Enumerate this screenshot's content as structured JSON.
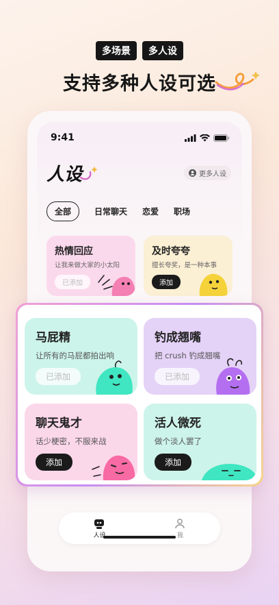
{
  "promo": {
    "tags": [
      "多场景",
      "多人设"
    ],
    "headline": "支持多种人设可选"
  },
  "status_bar": {
    "time": "9:41"
  },
  "page": {
    "title": "人设",
    "more_label": "更多人设"
  },
  "filters": [
    "全部",
    "日常聊天",
    "恋爱",
    "职场"
  ],
  "small_cards": [
    {
      "title": "热情回应",
      "desc": "让我来做大家的小太阳",
      "button": "已添加",
      "bg": "#fbd9ec"
    },
    {
      "title": "及时夸夸",
      "desc": "擅长夸奖，是一种本事",
      "button": "添加",
      "bg": "#fbefd4"
    }
  ],
  "big_cards": [
    {
      "title": "马屁精",
      "desc": "让所有的马屁都拍出响",
      "button": "已添加",
      "bg": "#cdf4ea"
    },
    {
      "title": "钓成翘嘴",
      "desc": "把 crush 钓成翘嘴",
      "button": "已添加",
      "bg": "#e4d2f7"
    },
    {
      "title": "聊天鬼才",
      "desc": "话少梗密，不服来战",
      "button": "添加",
      "bg": "#fbd7ea"
    },
    {
      "title": "活人微死",
      "desc": "做个淡人罢了",
      "button": "添加",
      "bg": "#cdf4ea"
    }
  ],
  "tab_bar": {
    "items": [
      {
        "label": "人设",
        "active": true
      },
      {
        "label": "我",
        "active": false
      }
    ]
  },
  "colors": {
    "accent_dark": "#1b1b1b",
    "mint": "#cdf4ea",
    "lavender": "#e4d2f7",
    "pink": "#fbd7ea",
    "cream": "#fbefd4"
  }
}
